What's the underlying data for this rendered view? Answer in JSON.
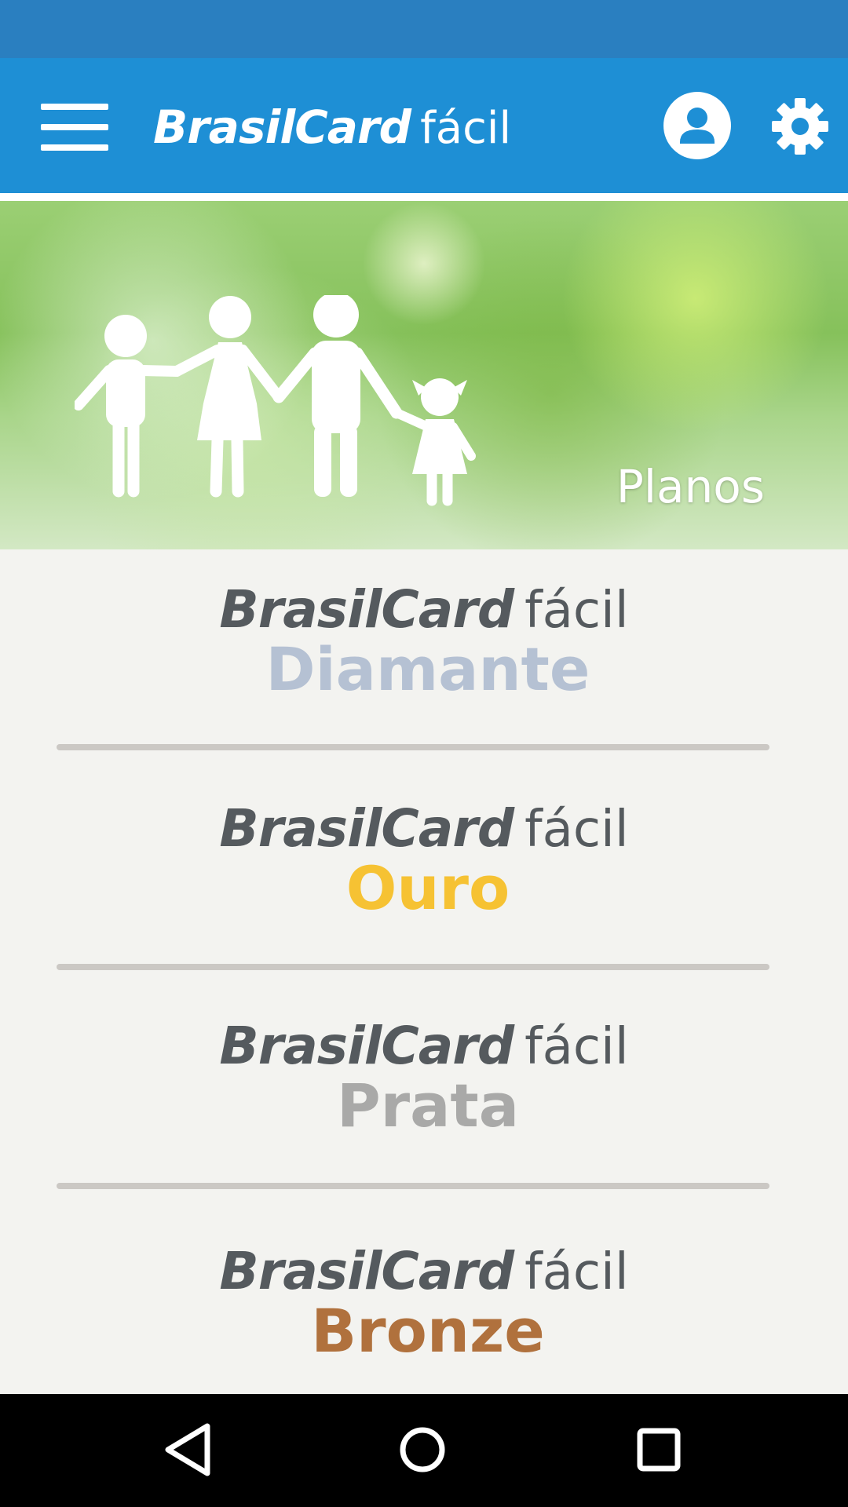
{
  "app": {
    "brand_bold": "BrasilCard",
    "brand_light": "fácil",
    "colors": {
      "status_bar": "#2a7fc0",
      "app_bar": "#1e8fd5",
      "background": "#f3f3f0"
    },
    "icons": {
      "menu": "hamburger-menu-icon",
      "profile": "user-profile-icon",
      "settings": "gear-icon"
    }
  },
  "banner": {
    "title": "Planos",
    "image": "family-silhouette-over-grass"
  },
  "plans": [
    {
      "brand_bold": "BrasilCard",
      "brand_light": "fácil",
      "name": "Diamante",
      "color": "#b5c1d3"
    },
    {
      "brand_bold": "BrasilCard",
      "brand_light": "fácil",
      "name": "Ouro",
      "color": "#f6c233"
    },
    {
      "brand_bold": "BrasilCard",
      "brand_light": "fácil",
      "name": "Prata",
      "color": "#a9a9a8"
    },
    {
      "brand_bold": "BrasilCard",
      "brand_light": "fácil",
      "name": "Bronze",
      "color": "#b0713d"
    }
  ],
  "system_nav": {
    "icons": [
      "back-icon",
      "home-icon",
      "recents-icon"
    ]
  }
}
